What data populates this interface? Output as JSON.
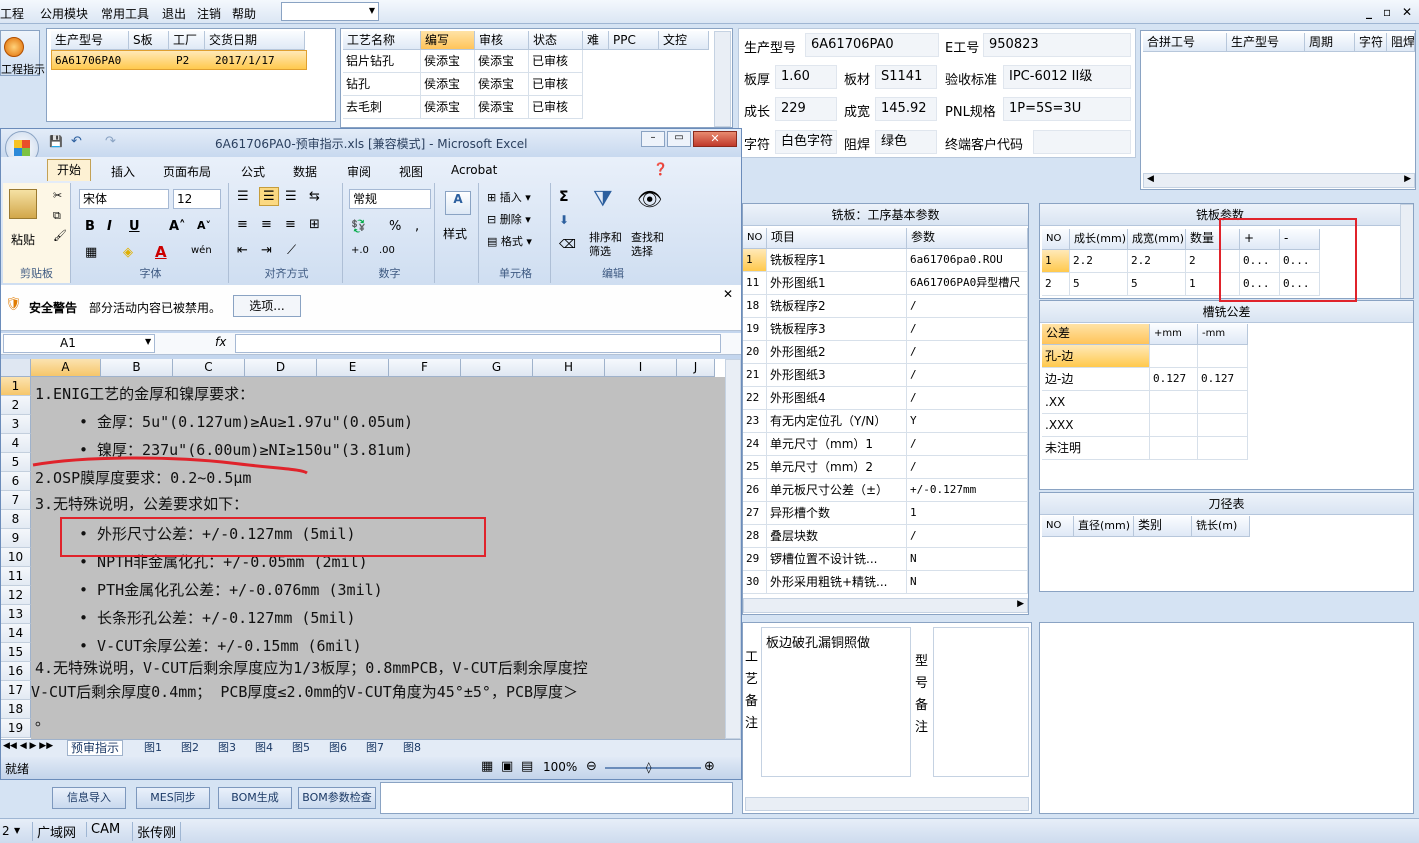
{
  "menubar": {
    "items": [
      "工程",
      "公用模块",
      "常用工具",
      "退出",
      "注销",
      "帮助"
    ],
    "combo_value": "",
    "win_min": "_",
    "win_restore": "▫",
    "win_close": "✕"
  },
  "left_app": {
    "btn_label": "工程指示"
  },
  "order_table": {
    "headers": [
      "生产型号",
      "S板",
      "工厂",
      "交货日期"
    ],
    "row": [
      "6A61706PA0",
      "",
      "P2",
      "2017/1/17"
    ]
  },
  "process_table": {
    "headers": [
      "工艺名称",
      "编写",
      "审核",
      "状态",
      "难",
      "PPC",
      "文控"
    ],
    "rows": [
      [
        "铝片钻孔",
        "侯添宝",
        "侯添宝",
        "已审核"
      ],
      [
        "钻孔",
        "侯添宝",
        "侯添宝",
        "已审核"
      ],
      [
        "去毛刺",
        "侯添宝",
        "侯添宝",
        "已审核"
      ]
    ]
  },
  "info": {
    "model_label": "生产型号",
    "model": "6A61706PA0",
    "e_label": "E工号",
    "e_no": "950823",
    "thick_label": "板厚",
    "thick": "1.60",
    "mat_label": "板材",
    "mat": "S1141",
    "std_label": "验收标准",
    "std": "IPC-6012 II级",
    "len_label": "成长",
    "len": "229",
    "wid_label": "成宽",
    "wid": "145.92",
    "pnl_label": "PNL规格",
    "pnl": "1P=5S=3U",
    "char_label": "字符",
    "char": "白色字符",
    "mask_label": "阻焊",
    "mask": "绿色",
    "cust_label": "终端客户代码",
    "cust": ""
  },
  "merge_table": {
    "headers": [
      "合拼工号",
      "生产型号",
      "周期",
      "字符",
      "阻焊"
    ]
  },
  "mill_base": {
    "caption": "铣板：工序基本参数",
    "headers": [
      "NO",
      "项目",
      "参数"
    ],
    "rows": [
      [
        "1",
        "铣板程序1",
        "6a61706pa0.ROU"
      ],
      [
        "11",
        "外形图纸1",
        "6A61706PA0异型槽尺"
      ],
      [
        "18",
        "铣板程序2",
        "/"
      ],
      [
        "19",
        "铣板程序3",
        "/"
      ],
      [
        "20",
        "外形图纸2",
        "/"
      ],
      [
        "21",
        "外形图纸3",
        "/"
      ],
      [
        "22",
        "外形图纸4",
        "/"
      ],
      [
        "23",
        "有无内定位孔（Y/N）",
        "Y"
      ],
      [
        "24",
        "单元尺寸（mm）1",
        "/"
      ],
      [
        "25",
        "单元尺寸（mm）2",
        "/"
      ],
      [
        "26",
        "单元板尺寸公差（±）",
        "+/-0.127mm"
      ],
      [
        "27",
        "异形槽个数",
        "1"
      ],
      [
        "28",
        "叠层块数",
        "/"
      ],
      [
        "29",
        "锣槽位置不设计铣...",
        "N"
      ],
      [
        "30",
        "外形采用粗铣+精铣...",
        "N"
      ]
    ]
  },
  "mill_params": {
    "caption": "铣板参数",
    "headers": [
      "NO",
      "成长(mm)",
      "成宽(mm)",
      "数量",
      "+",
      "-"
    ],
    "rows": [
      [
        "1",
        "2.2",
        "2.2",
        "2",
        "0...",
        "0..."
      ],
      [
        "2",
        "5",
        "5",
        "1",
        "0...",
        "0..."
      ]
    ]
  },
  "slot_tol": {
    "caption": "槽铣公差",
    "headers": [
      "公差",
      "+mm",
      "-mm"
    ],
    "rows": [
      [
        "孔-边",
        "",
        ""
      ],
      [
        "边-边",
        "0.127",
        "0.127"
      ],
      [
        ".XX",
        "",
        ""
      ],
      [
        ".XXX",
        "",
        ""
      ],
      [
        "未注明",
        "",
        ""
      ]
    ]
  },
  "tools": {
    "caption": "刀径表",
    "headers": [
      "NO",
      "直径(mm)",
      "类别",
      "铣长(m)"
    ]
  },
  "notes": {
    "craft_label": "工艺备注",
    "craft_text": "板边破孔漏铜照做",
    "model_label": "型号备注"
  },
  "bottom_buttons": [
    "信息导入",
    "MES同步",
    "BOM生成",
    "BOM参数检查"
  ],
  "statusbar": {
    "items": [
      "2",
      "广域网",
      "CAM",
      "张传刚"
    ]
  },
  "excel": {
    "title": "6A61706PA0-预审指示.xls  [兼容模式] - Microsoft Excel",
    "tabs": [
      "开始",
      "插入",
      "页面布局",
      "公式",
      "数据",
      "审阅",
      "视图",
      "Acrobat"
    ],
    "font_name": "宋体",
    "font_size": "12",
    "number_format": "常规",
    "groups": [
      "剪贴板",
      "字体",
      "对齐方式",
      "数字",
      "单元格",
      "编辑"
    ],
    "paste": "粘贴",
    "style": "样式",
    "insert": "插入",
    "delete": "删除",
    "format": "格式",
    "sort": "排序和筛选",
    "find": "查找和选择",
    "security_title": "安全警告",
    "security_text": "部分活动内容已被禁用。",
    "options_btn": "选项...",
    "name_box": "A1",
    "fx": "fx",
    "columns": [
      "A",
      "B",
      "C",
      "D",
      "E",
      "F",
      "G",
      "H",
      "I",
      "J"
    ],
    "rows": [
      "1",
      "2",
      "3",
      "4",
      "5",
      "6",
      "7",
      "8",
      "9",
      "10",
      "11",
      "12",
      "13",
      "14",
      "15",
      "16",
      "17",
      "18",
      "19"
    ],
    "lines": [
      "1.ENIG工艺的金厚和镍厚要求：",
      "• 金厚：5u\"(0.127um)≥Au≥1.97u\"(0.05um)",
      "• 镍厚：237u\"(6.00um)≥NI≥150u\"(3.81um)",
      "2.OSP膜厚度要求：0.2~0.5μm",
      "3.无特殊说明，公差要求如下：",
      "• 外形尺寸公差：+/-0.127mm (5mil)",
      "• NPTH非金属化孔：+/-0.05mm (2mil)",
      "• PTH金属化孔公差：+/-0.076mm (3mil)",
      "• 长条形孔公差：+/-0.127mm (5mil)",
      "• V-CUT余厚公差：+/-0.15mm (6mil)",
      "4.无特殊说明，V-CUT后剩余厚度应为1/3板厚；0.8mmPCB，V-CUT后剩余厚度控",
      "V-CUT后剩余厚度0.4mm； PCB厚度≤2.0mm的V-CUT角度为45°±5°，PCB厚度＞",
      "。"
    ],
    "sheets": [
      "预审指示",
      "图1",
      "图2",
      "图3",
      "图4",
      "图5",
      "图6",
      "图7",
      "图8"
    ],
    "status_ready": "就绪",
    "zoom": "100%"
  }
}
